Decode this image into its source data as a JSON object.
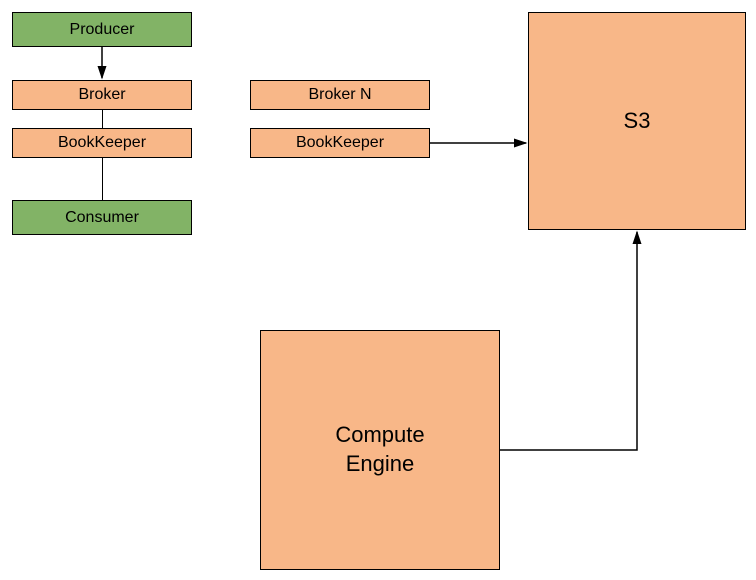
{
  "nodes": {
    "producer": "Producer",
    "broker1": "Broker",
    "brokerN": "Broker N",
    "bookkeeper1": "BookKeeper",
    "bookkeeper2": "BookKeeper",
    "consumer": "Consumer",
    "s3": "S3",
    "compute": "Compute\nEngine"
  }
}
